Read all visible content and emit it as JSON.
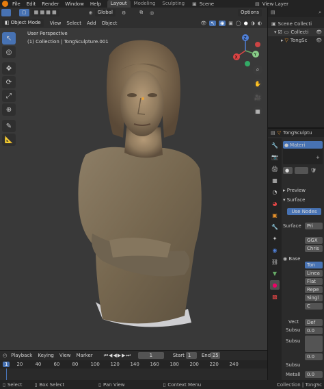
{
  "menu": [
    "File",
    "Edit",
    "Render",
    "Window",
    "Help"
  ],
  "workspaces": [
    "Layout",
    "Modeling",
    "Sculpting"
  ],
  "scene_label": "Scene",
  "view_layer_label": "View Layer",
  "viewport": {
    "mode": "Object Mode",
    "menus": [
      "View",
      "Select",
      "Add",
      "Object"
    ],
    "transform_orientation": "Global",
    "perspective": "User Perspective",
    "collection_line": "(1) Collection | TongSculpture.001",
    "options_label": "Options",
    "gizmo": {
      "x": "X",
      "y": "Y",
      "z": "Z"
    }
  },
  "outliner": {
    "scene_collection": "Scene Collecti",
    "collection": "Collecti",
    "object": "TongSc"
  },
  "properties": {
    "object_name": "TongSculptu",
    "material_name": "Materi",
    "preview": "Preview",
    "surface_section": "Surface",
    "use_nodes": "Use Nodes",
    "surface_label": "Surface",
    "surface_value": "Pri",
    "fields": [
      "GGX",
      "Chris",
      "",
      "Ton",
      "Linea",
      "Flat",
      "Repe",
      "Singl",
      "C",
      "",
      "Def",
      "0.0",
      "",
      "0.0"
    ],
    "base_label": "Base",
    "vect_label": "Vect",
    "subsu1": "Subsu",
    "subsu2": "Subsu",
    "subsu3": "Subsu",
    "metall": "Metall",
    "metall_value": "0.0"
  },
  "timeline": {
    "menus": [
      "Playback",
      "Keying",
      "View",
      "Marker"
    ],
    "current_frame": "1",
    "start_label": "Start",
    "start_value": "1",
    "end_label": "End",
    "end_value": "25",
    "ruler": [
      "1",
      "20",
      "40",
      "60",
      "80",
      "100",
      "120",
      "140",
      "160",
      "180",
      "200",
      "220",
      "240"
    ]
  },
  "status_bar": {
    "select": "Select",
    "box_select": "Box Select",
    "pan_view": "Pan View",
    "context_menu": "Context Menu",
    "stats": "Collection | TongSc"
  },
  "colors": {
    "accent": "#4772b3",
    "orange": "#e87d0d",
    "viewport_bg": "#393939"
  }
}
